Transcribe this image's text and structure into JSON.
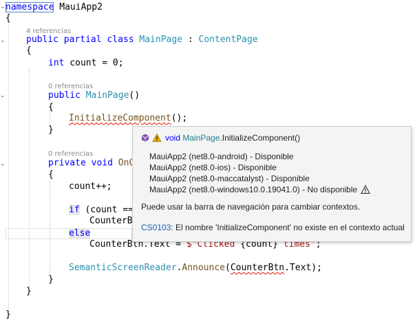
{
  "code": {
    "l1": {
      "kw": "namespace",
      "name": " MauiApp2"
    },
    "l2": "{",
    "lens1": "4 referencias",
    "l3": {
      "kw1": "public",
      "kw2": " partial",
      "kw3": " class",
      "type1": " MainPage",
      "colon": " :",
      "type2": " ContentPage"
    },
    "l4": "{",
    "l5": {
      "kw": "int",
      "rest": " count = 0;"
    },
    "lens2": "0 referencias",
    "l6": {
      "kw": "public",
      "method": " MainPage",
      "rest": "()"
    },
    "l7": "{",
    "l8": {
      "method": "InitializeComponent",
      "rest": "();"
    },
    "l9": "}",
    "lens3": "0 referencias",
    "l10": {
      "kw1": "private",
      "kw2": " void",
      "method": " OnC"
    },
    "l11": "{",
    "l12": "count++;",
    "l13": {
      "kw": "if",
      "rest": " (count ==",
      "tail": ""
    },
    "l14": "CounterB",
    "l15": {
      "kw": "else"
    },
    "l16": {
      "pre": "CounterBtn.Text = ",
      "str1": "$\"Clicked ",
      "interp": "{count}",
      "str2": " times\"",
      "end": ";"
    },
    "l17": {
      "type": "SemanticScreenReader",
      "dot": ".",
      "method": "Announce",
      "open": "(",
      "arg": "CounterBtn",
      "argrest": ".Text",
      "close": ");"
    },
    "l18": "}",
    "l19": "}",
    "l20": "}"
  },
  "tooltip": {
    "header_kw": "void",
    "header_type": "MainPage",
    "header_rest": ".InitializeComponent()",
    "platforms": [
      "MauiApp2 (net8.0-android) - Disponible",
      "MauiApp2 (net8.0-ios) - Disponible",
      "MauiApp2 (net8.0-maccatalyst) - Disponible",
      "MauiApp2 (net8.0-windows10.0.19041.0) - No disponible"
    ],
    "hint": "Puede usar la barra de navegación para cambiar contextos.",
    "error_code": "CS0103",
    "error_msg": ": El nombre 'InitializeComponent' no existe en el contexto actual"
  },
  "colors": {
    "keyword": "#0000ff",
    "type": "#2b91af",
    "method": "#74531f",
    "string": "#a31515",
    "error": "#e51400",
    "link": "#1a5fb4"
  }
}
